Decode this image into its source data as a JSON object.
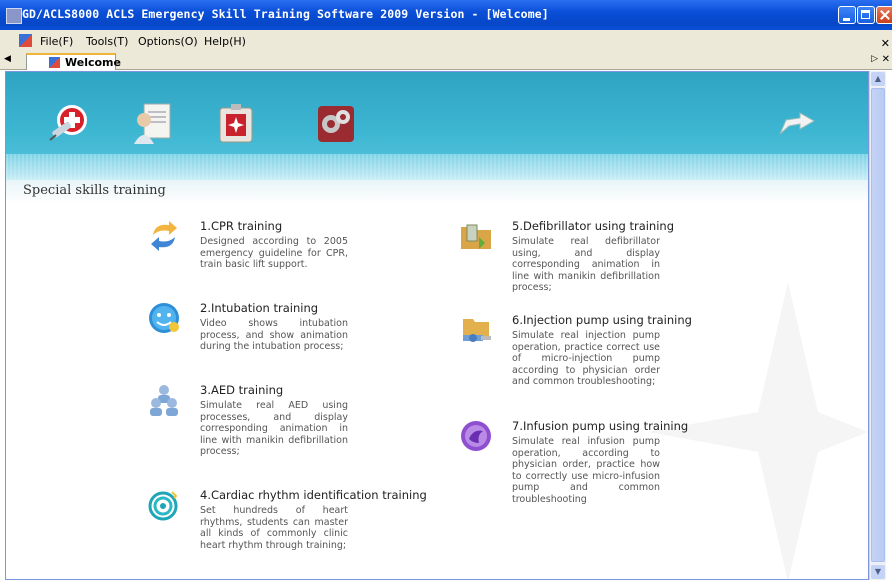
{
  "window": {
    "title": "GD/ACLS8000 ACLS Emergency Skill Training Software 2009 Version - [Welcome]"
  },
  "menu": [
    "File(F)",
    "Tools(T)",
    "Options(O)",
    "Help(H)"
  ],
  "tab": {
    "label": "Welcome"
  },
  "section_title": "Special skills training",
  "trainings": [
    {
      "title": "1.CPR training",
      "description": "Designed according to 2005 emergency guideline for CPR, train basic lift support.",
      "icon": "arrows-cycle-icon"
    },
    {
      "title": "2.Intubation training",
      "description": "Video shows intubation process, and show animation during the intubation process;",
      "icon": "blue-smiley-icon"
    },
    {
      "title": "3.AED training",
      "description": "Simulate real AED using processes, and display corresponding animation in line with manikin defibrillation process;",
      "icon": "people-group-icon"
    },
    {
      "title": "4.Cardiac rhythm identification training",
      "description": "Set hundreds of heart rhythms, students can master all kinds of commonly clinic heart rhythm through training;",
      "icon": "spiral-icon"
    },
    {
      "title": "5.Defibrillator using training",
      "description": "Simulate real defibrillator using, and display corresponding animation in line with manikin defibrillation process;",
      "icon": "defibrillator-folder-icon"
    },
    {
      "title": "6.Injection pump using training",
      "description": "Simulate real injection pump operation, practice correct use of micro-injection pump according to physician order and common troubleshooting;",
      "icon": "injection-pump-icon"
    },
    {
      "title": "7.Infusion pump using training",
      "description": "Simulate real infusion pump operation, according to physician order, practice how to correctly use micro-infusion pump and common troubleshooting",
      "icon": "purple-orb-icon"
    }
  ],
  "toolbar_icons": [
    "syringe-medical-icon",
    "doctor-chart-icon",
    "medical-kit-icon",
    "gears-icon",
    "return-arrow-icon"
  ]
}
